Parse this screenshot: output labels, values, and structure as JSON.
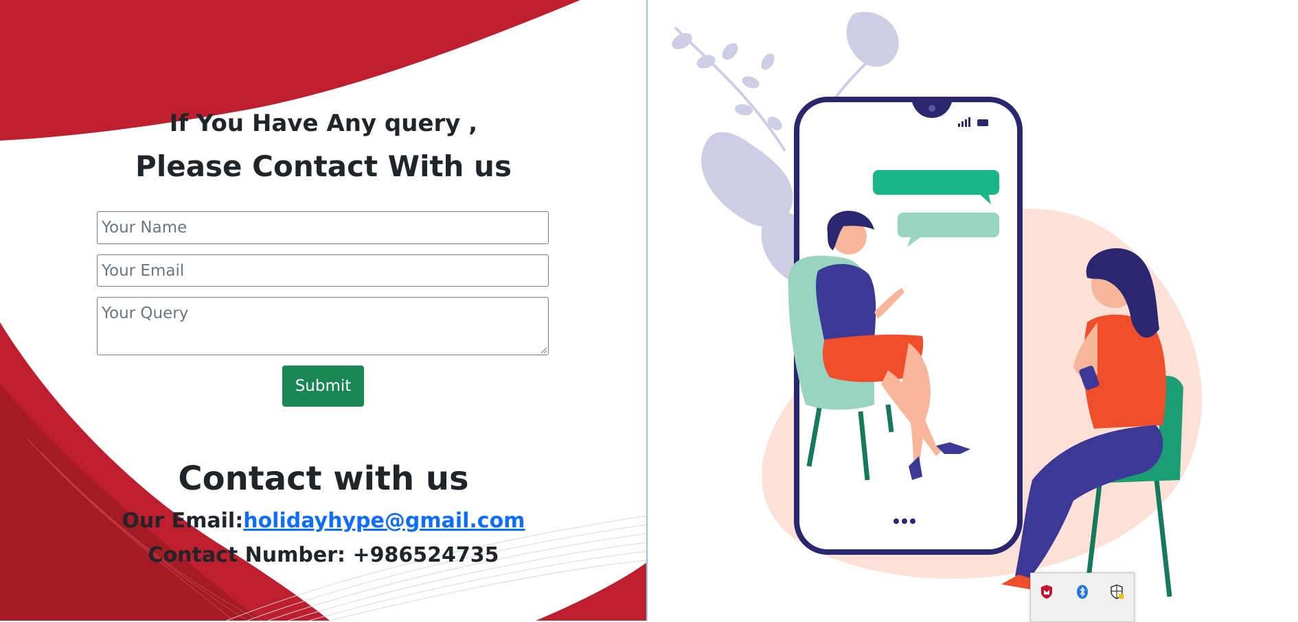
{
  "form": {
    "heading_line1": "If You Have Any query ,",
    "heading_line2": "Please Contact With us",
    "name_placeholder": "Your Name",
    "email_placeholder": "Your Email",
    "query_placeholder": "Your Query",
    "submit_label": "Submit"
  },
  "contact": {
    "title": "Contact with us",
    "email_label": "Our Email:",
    "email_value": "holidayhype@gmail.com",
    "phone_label": "Contact Number: ",
    "phone_value": "+986524735"
  },
  "colors": {
    "brand_red": "#be1e2d",
    "submit_green": "#198754",
    "link_blue": "#0d6efd",
    "divider": "#7fd3e6"
  },
  "illustration": {
    "description_icon": "chat-illustration-icon"
  },
  "tray": {
    "icons": [
      "mcafee-icon",
      "bluetooth-icon",
      "security-shield-icon"
    ]
  }
}
